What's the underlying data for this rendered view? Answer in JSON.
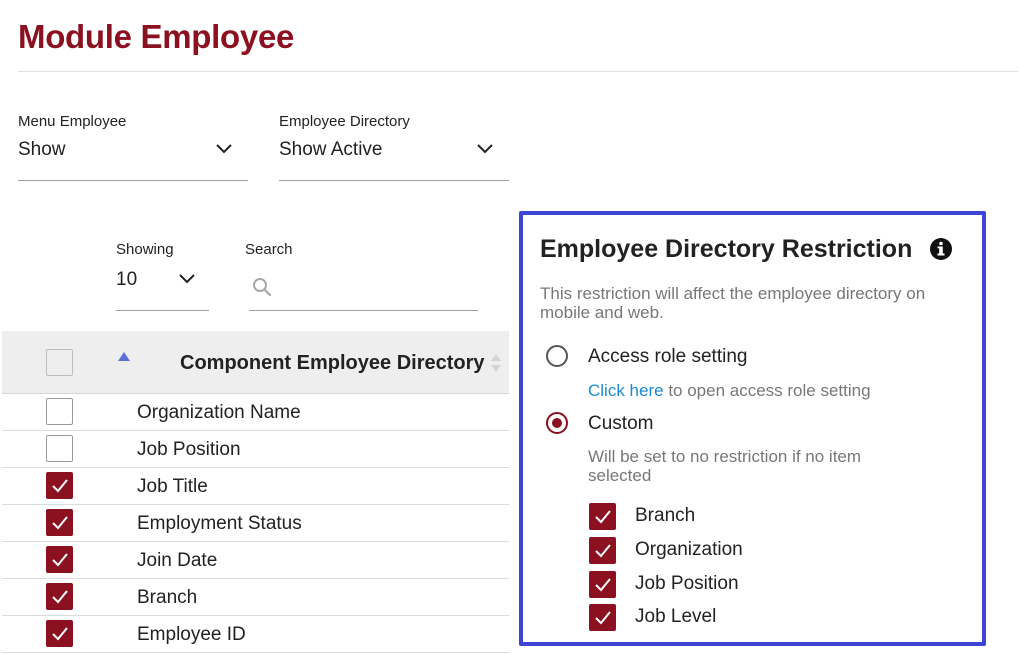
{
  "page": {
    "title": "Module Employee"
  },
  "filters": {
    "menu_employee": {
      "label": "Menu Employee",
      "value": "Show"
    },
    "employee_directory": {
      "label": "Employee Directory",
      "value": "Show Active"
    }
  },
  "table_controls": {
    "showing": {
      "label": "Showing",
      "value": "10"
    },
    "search": {
      "label": "Search",
      "value": "",
      "placeholder": ""
    }
  },
  "table": {
    "header": "Component Employee Directory",
    "header_checked": false,
    "rows": [
      {
        "label": "Organization Name",
        "checked": false
      },
      {
        "label": "Job Position",
        "checked": false
      },
      {
        "label": "Job Title",
        "checked": true
      },
      {
        "label": "Employment Status",
        "checked": true
      },
      {
        "label": "Join Date",
        "checked": true
      },
      {
        "label": "Branch",
        "checked": true
      },
      {
        "label": "Employee ID",
        "checked": true
      }
    ]
  },
  "restriction_panel": {
    "title": "Employee Directory Restriction",
    "description": "This restriction will affect the employee directory on mobile and web.",
    "options": {
      "access_role": {
        "label": "Access role setting",
        "selected": false,
        "link_text": "Click here",
        "link_suffix": " to open access role setting"
      },
      "custom": {
        "label": "Custom",
        "selected": true,
        "hint": "Will be set to no restriction if no item selected"
      }
    },
    "custom_items": [
      {
        "label": "Branch",
        "checked": true
      },
      {
        "label": "Organization",
        "checked": true
      },
      {
        "label": "Job Position",
        "checked": true
      },
      {
        "label": "Job Level",
        "checked": true
      }
    ]
  },
  "colors": {
    "brand": "#8b1020",
    "highlight_border": "#3d46d4",
    "link": "#1a8ad4",
    "sort_arrow": "#5b6fd6"
  }
}
